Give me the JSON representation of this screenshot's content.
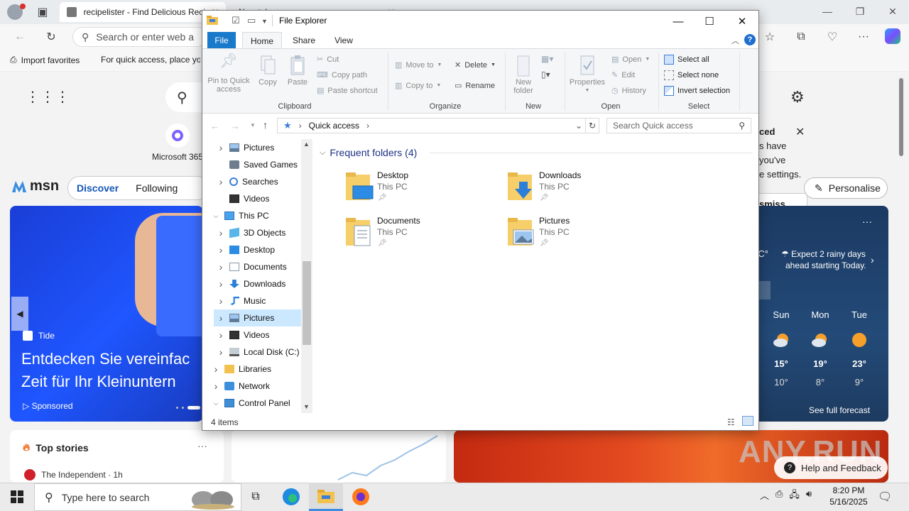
{
  "browser": {
    "tab1_title": "recipelister - Find Delicious Reci",
    "tab2_title": "New tab",
    "address_placeholder": "Search or enter web a",
    "favorites": {
      "import": "Import favorites",
      "hint": "For quick access, place yo"
    }
  },
  "msn": {
    "m365_label": "Microsoft 365",
    "logo_text": "msn",
    "tabs": [
      "Discover",
      "Following"
    ],
    "hero": {
      "source": "Tide",
      "title_line1": "Entdecken Sie vereinfac",
      "title_line2": "Zeit für Ihr Kleinuntern",
      "sponsored": "Sponsored"
    },
    "top_stories": {
      "title": "Top stories",
      "more": "···",
      "source": "The Independent · 1h"
    },
    "notification": {
      "line1": "ced",
      "line2": "s have",
      "line3": "you've",
      "line4": "e settings.",
      "dismiss": "smiss"
    },
    "personalise": "Personalise",
    "weather": {
      "unit": "°C",
      "summary_line1": "Expect 2 rainy days",
      "summary_line2": "ahead starting Today.",
      "days": [
        {
          "day": "Sun",
          "hi": "15°",
          "lo": "10°",
          "icon": "partly-cloudy"
        },
        {
          "day": "Mon",
          "hi": "19°",
          "lo": "8°",
          "icon": "partly-cloudy"
        },
        {
          "day": "Tue",
          "hi": "23°",
          "lo": "9°",
          "icon": "sunny"
        }
      ],
      "forecast_link": "See full forecast"
    },
    "help_feedback": "Help and Feedback",
    "watermark": "ANY.RUN"
  },
  "explorer": {
    "title": "File Explorer",
    "ribbon_tabs": {
      "file": "File",
      "home": "Home",
      "share": "Share",
      "view": "View"
    },
    "clipboard": {
      "pin_line1": "Pin to Quick",
      "pin_line2": "access",
      "copy": "Copy",
      "paste": "Paste",
      "cut": "Cut",
      "copy_path": "Copy path",
      "paste_shortcut": "Paste shortcut",
      "group": "Clipboard"
    },
    "organize": {
      "move_to": "Move to",
      "copy_to": "Copy to",
      "delete": "Delete",
      "rename": "Rename",
      "group": "Organize"
    },
    "new": {
      "new_folder_line1": "New",
      "new_folder_line2": "folder",
      "group": "New"
    },
    "open": {
      "properties": "Properties",
      "open": "Open",
      "edit": "Edit",
      "history": "History",
      "group": "Open"
    },
    "select": {
      "select_all": "Select all",
      "select_none": "Select none",
      "invert": "Invert selection",
      "group": "Select"
    },
    "address": "Quick access",
    "search_placeholder": "Search Quick access",
    "tree": [
      {
        "label": "Pictures",
        "indent": 1,
        "chevron": true,
        "icon": "pictures",
        "selected": false
      },
      {
        "label": "Saved Games",
        "indent": 1,
        "chevron": false,
        "icon": "saved-games",
        "selected": false
      },
      {
        "label": "Searches",
        "indent": 1,
        "chevron": true,
        "icon": "searches",
        "selected": false
      },
      {
        "label": "Videos",
        "indent": 1,
        "chevron": false,
        "icon": "videos",
        "selected": false
      },
      {
        "label": "This PC",
        "indent": 0,
        "chevron": "open",
        "icon": "this-pc",
        "selected": false
      },
      {
        "label": "3D Objects",
        "indent": 1,
        "chevron": true,
        "icon": "3d-objects",
        "selected": false
      },
      {
        "label": "Desktop",
        "indent": 1,
        "chevron": true,
        "icon": "desktop",
        "selected": false
      },
      {
        "label": "Documents",
        "indent": 1,
        "chevron": true,
        "icon": "documents",
        "selected": false
      },
      {
        "label": "Downloads",
        "indent": 1,
        "chevron": true,
        "icon": "downloads",
        "selected": false
      },
      {
        "label": "Music",
        "indent": 1,
        "chevron": true,
        "icon": "music",
        "selected": false
      },
      {
        "label": "Pictures",
        "indent": 1,
        "chevron": true,
        "icon": "pictures",
        "selected": true
      },
      {
        "label": "Videos",
        "indent": 1,
        "chevron": true,
        "icon": "videos",
        "selected": false
      },
      {
        "label": "Local Disk (C:)",
        "indent": 1,
        "chevron": true,
        "icon": "local-disk",
        "selected": false
      },
      {
        "label": "Libraries",
        "indent": 0,
        "chevron": true,
        "icon": "libraries",
        "selected": false
      },
      {
        "label": "Network",
        "indent": 0,
        "chevron": true,
        "icon": "network",
        "selected": false
      },
      {
        "label": "Control Panel",
        "indent": 0,
        "chevron": "open",
        "icon": "control-panel",
        "selected": false
      }
    ],
    "frequent_header": "Frequent folders (4)",
    "folders": [
      {
        "name": "Desktop",
        "location": "This PC",
        "icon": "desktop-folder"
      },
      {
        "name": "Downloads",
        "location": "This PC",
        "icon": "downloads-folder"
      },
      {
        "name": "Documents",
        "location": "This PC",
        "icon": "documents-folder"
      },
      {
        "name": "Pictures",
        "location": "This PC",
        "icon": "pictures-folder"
      }
    ],
    "status": "4 items"
  },
  "taskbar": {
    "search_placeholder": "Type here to search",
    "time": "8:20 PM",
    "date": "5/16/2025"
  }
}
